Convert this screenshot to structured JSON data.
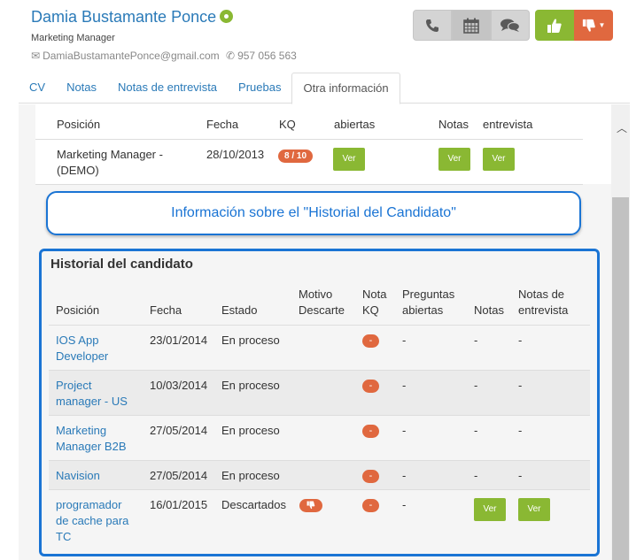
{
  "candidate": {
    "name": "Damia Bustamante Ponce",
    "title": "Marketing Manager",
    "email": "DamiaBustamantePonce@gmail.com",
    "phone": "957 056 563"
  },
  "actions": {
    "icons": [
      "phone-icon",
      "calendar-icon",
      "chat-icon",
      "thumbs-up-icon",
      "thumbs-down-icon"
    ],
    "colors": {
      "approve": "#8ab833",
      "reject": "#e0683f",
      "neutral": "#d4d4d4"
    }
  },
  "tabs": [
    "CV",
    "Notas",
    "Notas de entrevista",
    "Pruebas",
    "Otra información"
  ],
  "active_tab": "Otra información",
  "top_table": {
    "headers": {
      "posicion": "Posición",
      "fecha": "Fecha",
      "kq": "KQ",
      "abiertas": "abiertas",
      "notas": "Notas",
      "entrevista": "entrevista"
    },
    "row": {
      "posicion": "Marketing Manager - (DEMO)",
      "fecha": "28/10/2013",
      "kq": "8 / 10",
      "ver1": "Ver",
      "ver2": "Ver",
      "ver3": "Ver"
    }
  },
  "callout": "Información sobre el \"Historial del Candidato\"",
  "history": {
    "title": "Historial del candidato",
    "headers": {
      "posicion": "Posición",
      "fecha": "Fecha",
      "estado": "Estado",
      "motivo_1": "Motivo",
      "motivo_2": "Descarte",
      "nota_1": "Nota",
      "nota_2": "KQ",
      "preguntas_1": "Preguntas",
      "preguntas_2": "abiertas",
      "notas": "Notas",
      "notas_entrevista_1": "Notas de",
      "notas_entrevista_2": "entrevista"
    },
    "rows": [
      {
        "posicion_1": "IOS App",
        "posicion_2": "Developer",
        "posicion_3": "",
        "fecha": "23/01/2014",
        "estado": "En proceso",
        "nota_kq": "-",
        "preguntas": "-",
        "notas": "-",
        "notas_entrevista": "-"
      },
      {
        "posicion_1": "Project",
        "posicion_2": "manager - US",
        "posicion_3": "",
        "fecha": "10/03/2014",
        "estado": "En proceso",
        "nota_kq": "-",
        "preguntas": "-",
        "notas": "-",
        "notas_entrevista": "-"
      },
      {
        "posicion_1": "Marketing",
        "posicion_2": "Manager B2B",
        "posicion_3": "",
        "fecha": "27/05/2014",
        "estado": "En proceso",
        "nota_kq": "-",
        "preguntas": "-",
        "notas": "-",
        "notas_entrevista": "-"
      },
      {
        "posicion_1": "Navision",
        "posicion_2": "",
        "posicion_3": "",
        "fecha": "27/05/2014",
        "estado": "En proceso",
        "nota_kq": "-",
        "preguntas": "-",
        "notas": "-",
        "notas_entrevista": "-"
      },
      {
        "posicion_1": "programador",
        "posicion_2": "de cache para",
        "posicion_3": "TC",
        "fecha": "16/01/2015",
        "estado": "Descartados",
        "nota_kq": "-",
        "preguntas": "-",
        "notas": "Ver",
        "notas_entrevista": "Ver",
        "motivo_icon": "thumbs-down-icon"
      }
    ]
  }
}
